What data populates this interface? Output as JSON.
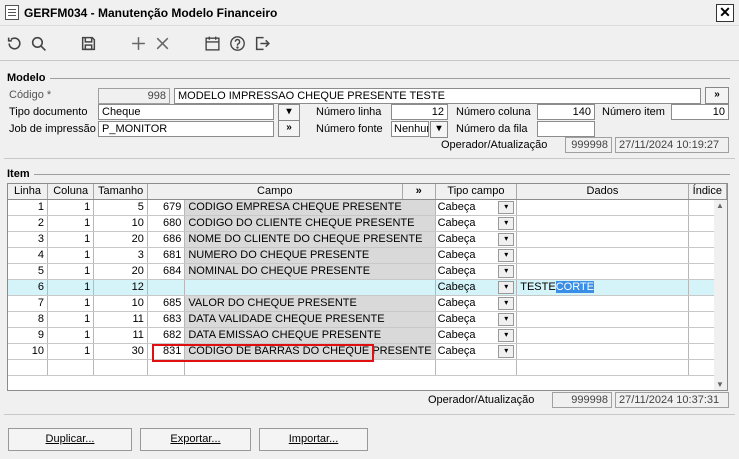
{
  "window": {
    "title": "GERFM034 - Manutenção Modelo Financeiro",
    "close_glyph": "✕"
  },
  "toolbar": {
    "icons": [
      "refresh-icon",
      "search-icon",
      "save-icon",
      "add-icon",
      "delete-icon",
      "calendar-icon",
      "help-icon",
      "exit-icon"
    ]
  },
  "modelo": {
    "section_title": "Modelo",
    "codigo_label": "Código *",
    "codigo_value": "998",
    "descricao_value": "MODELO IMPRESSAO CHEQUE PRESENTE TESTE",
    "lookup_glyph": "»",
    "tipo_doc_label": "Tipo documento",
    "tipo_doc_value": "Cheque",
    "numero_linha_label": "Número linha",
    "numero_linha_value": "12",
    "numero_coluna_label": "Número coluna",
    "numero_coluna_value": "140",
    "numero_item_label": "Número item",
    "numero_item_value": "10",
    "job_label": "Job de impressão",
    "job_value": "P_MONITOR",
    "numero_fonte_label": "Número fonte",
    "numero_fonte_value": "Nenhum",
    "numero_fila_label": "Número da fila",
    "numero_fila_value": "",
    "operador_label": "Operador/Atualização",
    "operador_value": "999998",
    "atualizacao_value": "27/11/2024 10:19:27"
  },
  "item": {
    "section_title": "Item",
    "columns": [
      "Linha",
      "Coluna",
      "Tamanho",
      "Campo",
      "»",
      "Tipo campo",
      "Dados",
      "Índice"
    ],
    "rows": [
      {
        "linha": "1",
        "coluna": "1",
        "tamanho": "5",
        "cod": "679",
        "campo": "CODIGO EMPRESA CHEQUE PRESENTE",
        "tipo": "Cabeça",
        "dados": ""
      },
      {
        "linha": "2",
        "coluna": "1",
        "tamanho": "10",
        "cod": "680",
        "campo": "CODIGO DO CLIENTE CHEQUE PRESENTE",
        "tipo": "Cabeça",
        "dados": ""
      },
      {
        "linha": "3",
        "coluna": "1",
        "tamanho": "20",
        "cod": "686",
        "campo": "NOME DO CLIENTE DO CHEQUE PRESENTE",
        "tipo": "Cabeça",
        "dados": ""
      },
      {
        "linha": "4",
        "coluna": "1",
        "tamanho": "3",
        "cod": "681",
        "campo": "NUMERO DO CHEQUE PRESENTE",
        "tipo": "Cabeça",
        "dados": ""
      },
      {
        "linha": "5",
        "coluna": "1",
        "tamanho": "20",
        "cod": "684",
        "campo": "NOMINAL DO CHEQUE PRESENTE",
        "tipo": "Cabeça",
        "dados": ""
      },
      {
        "linha": "6",
        "coluna": "1",
        "tamanho": "12",
        "cod": "",
        "campo": "",
        "tipo": "Cabeça",
        "dados_plain": "TESTE",
        "dados_selected": "CORTE"
      },
      {
        "linha": "7",
        "coluna": "1",
        "tamanho": "10",
        "cod": "685",
        "campo": "VALOR DO CHEQUE PRESENTE",
        "tipo": "Cabeça",
        "dados": ""
      },
      {
        "linha": "8",
        "coluna": "1",
        "tamanho": "11",
        "cod": "683",
        "campo": "DATA VALIDADE CHEQUE PRESENTE",
        "tipo": "Cabeça",
        "dados": ""
      },
      {
        "linha": "9",
        "coluna": "1",
        "tamanho": "11",
        "cod": "682",
        "campo": "DATA EMISSAO CHEQUE PRESENTE",
        "tipo": "Cabeça",
        "dados": ""
      },
      {
        "linha": "10",
        "coluna": "1",
        "tamanho": "30",
        "cod": "831",
        "campo": "CODIGO DE BARRAS DO CHEQUE PRESENTE",
        "tipo": "Cabeça",
        "dados": ""
      }
    ],
    "operador_label": "Operador/Atualização",
    "operador_value": "999998",
    "atualizacao_value": "27/11/2024 10:37:31"
  },
  "buttons": {
    "duplicar": "Duplicar...",
    "exportar": "Exportar...",
    "importar": "Importar..."
  }
}
